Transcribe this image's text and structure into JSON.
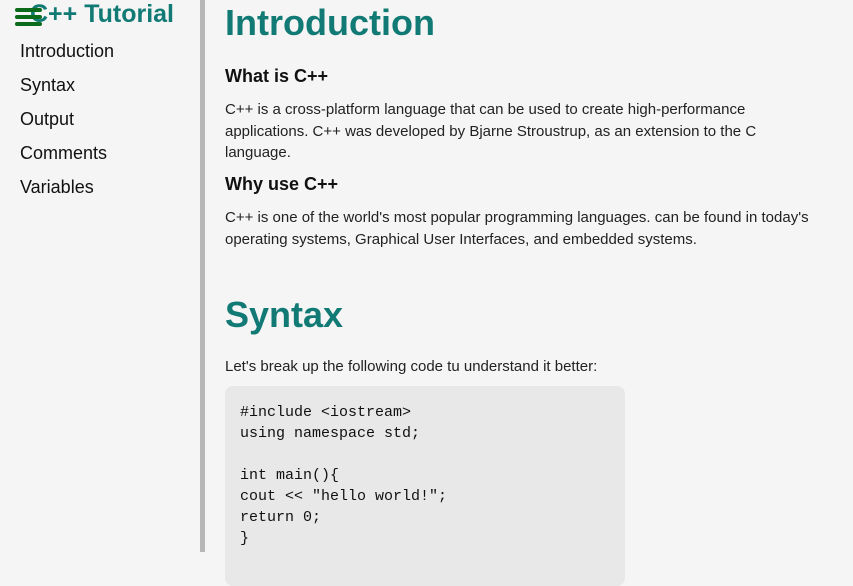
{
  "sidebar": {
    "title": "C++ Tutorial",
    "menu_icon": "hamburger-menu-icon",
    "items": [
      {
        "label": "Introduction"
      },
      {
        "label": "Syntax"
      },
      {
        "label": "Output"
      },
      {
        "label": "Comments"
      },
      {
        "label": "Variables"
      }
    ]
  },
  "main": {
    "introduction": {
      "heading": "Introduction",
      "what_heading": "What is C++",
      "what_text": "C++ is a cross-platform language that can be used to create high-performance applications. C++ was developed by Bjarne Stroustrup, as an extension to the C language.",
      "why_heading": "Why use C++",
      "why_text": "C++ is one of the world's most popular programming languages. can be found in today's operating systems, Graphical User Interfaces, and embedded systems."
    },
    "syntax": {
      "heading": "Syntax",
      "intro_text": "Let's break up the following code tu understand it better:",
      "code_lines": [
        "#include <iostream>",
        "using namespace std;",
        "",
        "int main(){",
        "cout << \"hello world!\";",
        "return 0;",
        "}"
      ]
    }
  },
  "colors": {
    "accent": "#117a75",
    "menu_icon": "#0b6b1b",
    "background": "#f5f5f5",
    "code_background": "#e8e8e8",
    "sidebar_border": "#b7b7b7"
  }
}
